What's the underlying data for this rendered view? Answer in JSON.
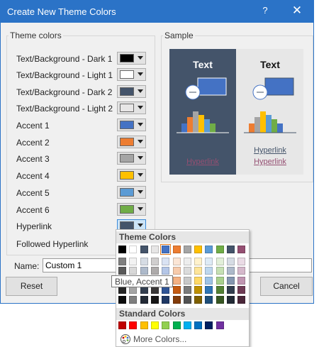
{
  "dialog": {
    "title": "Create New Theme Colors",
    "help_glyph": "?",
    "close_glyph": "✕"
  },
  "theme_colors": {
    "label": "Theme colors",
    "rows": [
      {
        "label": "Text/Background - Dark 1",
        "color": "#000000"
      },
      {
        "label": "Text/Background - Light 1",
        "color": "#ffffff"
      },
      {
        "label": "Text/Background - Dark 2",
        "color": "#44546a"
      },
      {
        "label": "Text/Background - Light 2",
        "color": "#e7e6e6"
      },
      {
        "label": "Accent 1",
        "color": "#4472c4"
      },
      {
        "label": "Accent 2",
        "color": "#ed7d31"
      },
      {
        "label": "Accent 3",
        "color": "#a5a5a5"
      },
      {
        "label": "Accent 4",
        "color": "#ffc000"
      },
      {
        "label": "Accent 5",
        "color": "#5b9bd5"
      },
      {
        "label": "Accent 6",
        "color": "#70ad47"
      },
      {
        "label": "Hyperlink",
        "color": "#44546a"
      },
      {
        "label": "Followed Hyperlink",
        "color": "#954f72"
      }
    ]
  },
  "sample": {
    "label": "Sample",
    "dark_text": "Text",
    "dark_link": "Hyperlink",
    "light_text": "Text",
    "light_link": "Hyperlink",
    "light_followed": "Hyperlink"
  },
  "name": {
    "label": "Name:",
    "value": "Custom 1"
  },
  "buttons": {
    "reset": "Reset",
    "cancel": "Cancel"
  },
  "dropdown": {
    "theme_header": "Theme Colors",
    "standard_header": "Standard Colors",
    "more_colors": "More Colors...",
    "tooltip": "Blue, Accent 1",
    "theme_top_row": [
      "#000000",
      "#ffffff",
      "#44546a",
      "#e7e6e6",
      "#4472c4",
      "#ed7d31",
      "#a5a5a5",
      "#ffc000",
      "#5b9bd5",
      "#70ad47",
      "#44546a",
      "#954f72"
    ],
    "theme_shades": [
      [
        "#7f7f7f",
        "#f2f2f2",
        "#d6dce4",
        "#d0cece",
        "#d9e2f3",
        "#fbe5d5",
        "#ededed",
        "#fff2cc",
        "#deebf6",
        "#e2efd9",
        "#d6dce4",
        "#eadbe5"
      ],
      [
        "#595959",
        "#d8d8d8",
        "#adb9ca",
        "#aeabab",
        "#b4c6e7",
        "#f7cbac",
        "#dbdbdb",
        "#fee599",
        "#bdd7ee",
        "#c5e0b3",
        "#adb9ca",
        "#d5b8cb"
      ],
      [
        "#3f3f3f",
        "#bfbfbf",
        "#8496b0",
        "#757070",
        "#8eaadb",
        "#f4b183",
        "#c9c9c9",
        "#ffd966",
        "#9dc3e6",
        "#a8d08d",
        "#8496b0",
        "#c095b1"
      ],
      [
        "#262626",
        "#a5a5a5",
        "#323e4f",
        "#3a3838",
        "#2f5496",
        "#c55a11",
        "#7b7b7b",
        "#bf9000",
        "#2e75b5",
        "#538135",
        "#323e4f",
        "#6f3b55"
      ],
      [
        "#0c0c0c",
        "#7f7f7f",
        "#222a35",
        "#171616",
        "#1f3864",
        "#833c0b",
        "#525252",
        "#7f6000",
        "#1e4e79",
        "#375623",
        "#222a35",
        "#4a2739"
      ]
    ],
    "standard_colors": [
      "#c00000",
      "#ff0000",
      "#ffc000",
      "#ffff00",
      "#92d050",
      "#00b050",
      "#00b0f0",
      "#0070c0",
      "#002060",
      "#7030a0"
    ]
  }
}
